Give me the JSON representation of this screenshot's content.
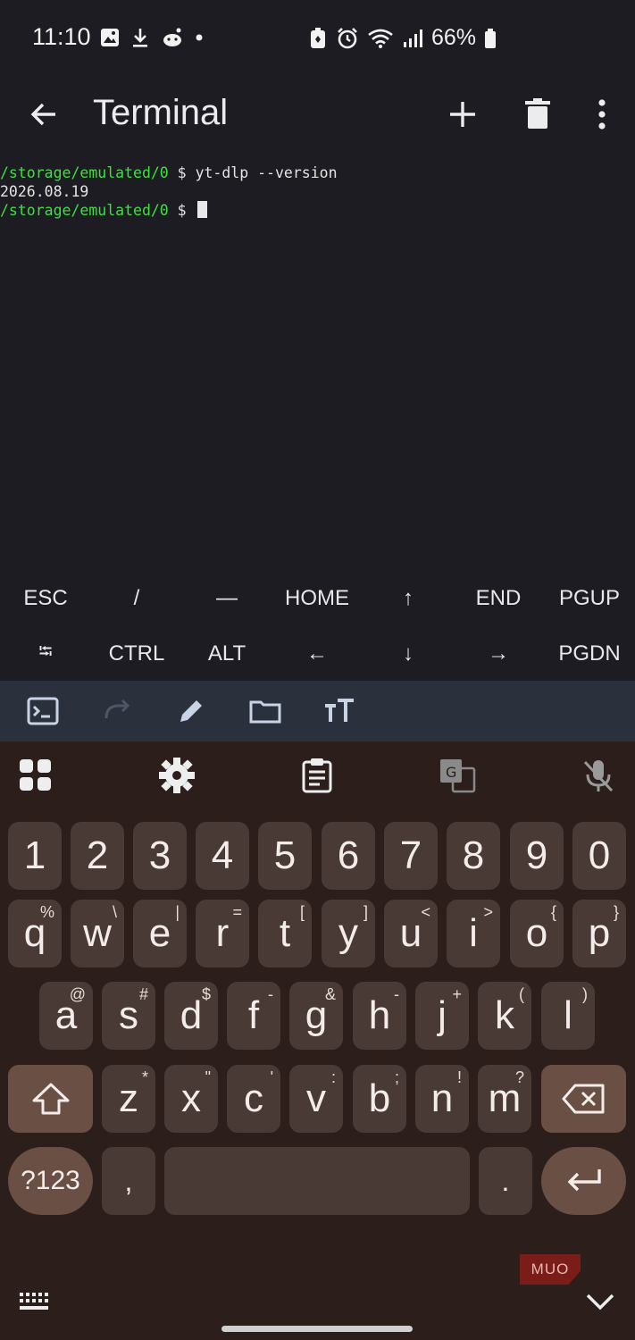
{
  "status_bar": {
    "time": "11:10",
    "battery": "66%",
    "left_icons": [
      "gallery-icon",
      "download-icon",
      "reddit-icon",
      "dot-icon"
    ],
    "right_icons": [
      "battery-saver-icon",
      "alarm-icon",
      "wifi-icon",
      "signal-icon",
      "battery-icon"
    ]
  },
  "app_bar": {
    "title": "Terminal",
    "actions": [
      "back-arrow-icon",
      "plus-icon",
      "trash-icon",
      "more-vert-icon"
    ]
  },
  "terminal": {
    "lines": [
      {
        "prompt": "/storage/emulated/0",
        "symbol": " $ ",
        "command": "yt-dlp --version"
      },
      {
        "output": "2026.08.19"
      },
      {
        "prompt": "/storage/emulated/0",
        "symbol": " $ ",
        "command": ""
      }
    ],
    "prompt_color": "#3ee03e"
  },
  "extra_keys": {
    "row1": [
      "ESC",
      "/",
      "—",
      "HOME",
      "↑",
      "END",
      "PGUP"
    ],
    "row2": [
      "⭾",
      "CTRL",
      "ALT",
      "←",
      "↓",
      "→",
      "PGDN"
    ]
  },
  "toolbar": {
    "icons": [
      "terminal-icon",
      "redo-icon",
      "pencil-icon",
      "folder-icon",
      "text-size-icon"
    ]
  },
  "keyboard": {
    "toolbar_icons": [
      "apps-grid-icon",
      "settings-icon",
      "clipboard-icon",
      "translate-icon",
      "mic-off-icon"
    ],
    "row_numbers": [
      "1",
      "2",
      "3",
      "4",
      "5",
      "6",
      "7",
      "8",
      "9",
      "0"
    ],
    "row_q": [
      {
        "k": "q",
        "h": "%"
      },
      {
        "k": "w",
        "h": "\\"
      },
      {
        "k": "e",
        "h": "|"
      },
      {
        "k": "r",
        "h": "="
      },
      {
        "k": "t",
        "h": "["
      },
      {
        "k": "y",
        "h": "]"
      },
      {
        "k": "u",
        "h": "<"
      },
      {
        "k": "i",
        "h": ">"
      },
      {
        "k": "o",
        "h": "{"
      },
      {
        "k": "p",
        "h": "}"
      }
    ],
    "row_a": [
      {
        "k": "a",
        "h": "@"
      },
      {
        "k": "s",
        "h": "#"
      },
      {
        "k": "d",
        "h": "$"
      },
      {
        "k": "f",
        "h": "-"
      },
      {
        "k": "g",
        "h": "&"
      },
      {
        "k": "h",
        "h": "-"
      },
      {
        "k": "j",
        "h": "+"
      },
      {
        "k": "k",
        "h": "("
      },
      {
        "k": "l",
        "h": ")"
      }
    ],
    "row_z": [
      {
        "k": "z",
        "h": "*"
      },
      {
        "k": "x",
        "h": "\""
      },
      {
        "k": "c",
        "h": "'"
      },
      {
        "k": "v",
        "h": ":"
      },
      {
        "k": "b",
        "h": ";"
      },
      {
        "k": "n",
        "h": "!"
      },
      {
        "k": "m",
        "h": "?"
      }
    ],
    "symbols_label": "?123",
    "comma": ",",
    "period": ".",
    "watermark": "MUO"
  },
  "colors": {
    "background": "#1c1c22",
    "toolbar": "#2b313c",
    "keyboard": "#2b1e1b",
    "key": "#4a3a35",
    "special_key": "#6a4f45"
  }
}
